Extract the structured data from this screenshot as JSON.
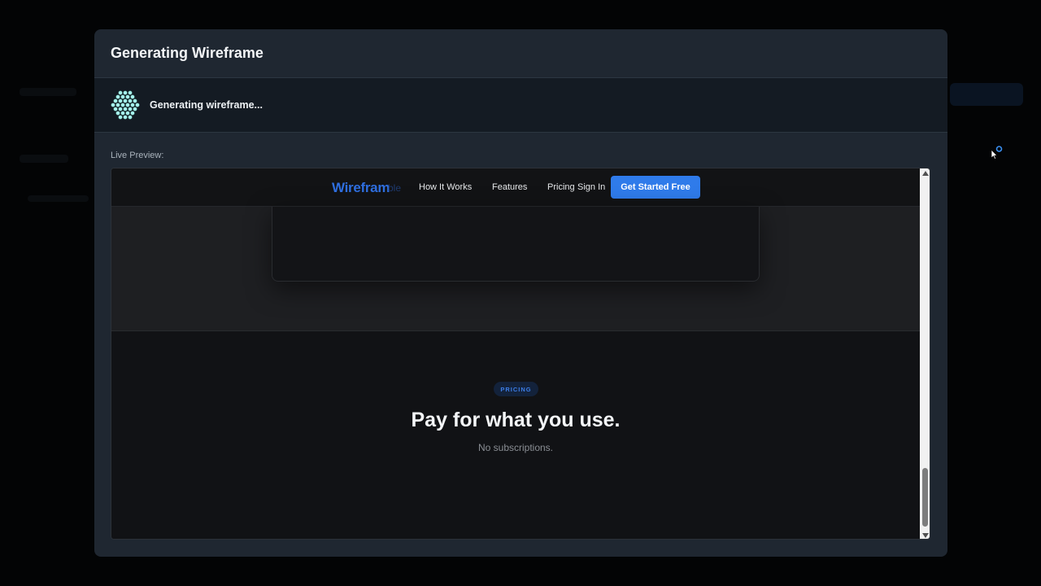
{
  "modal": {
    "title": "Generating Wireframe",
    "status_text": "Generating wireframe...",
    "live_preview_label": "Live Preview:"
  },
  "preview": {
    "nav": {
      "logo": "Wirefram",
      "logo_fade": "ble",
      "links": [
        "How It Works",
        "Features",
        "Pricing",
        "Sign In"
      ],
      "cta": "Get Started Free"
    },
    "pricing": {
      "badge": "PRICING",
      "heading": "Pay for what you use.",
      "subheading": "No subscriptions."
    }
  },
  "icons": {
    "status": "hexagon-cluster-icon",
    "cursor": "cursor-loading-icon"
  },
  "colors": {
    "accent": "#2f7bea",
    "icon_teal": "#a6f2ec",
    "modal_bg": "#1f2731"
  }
}
